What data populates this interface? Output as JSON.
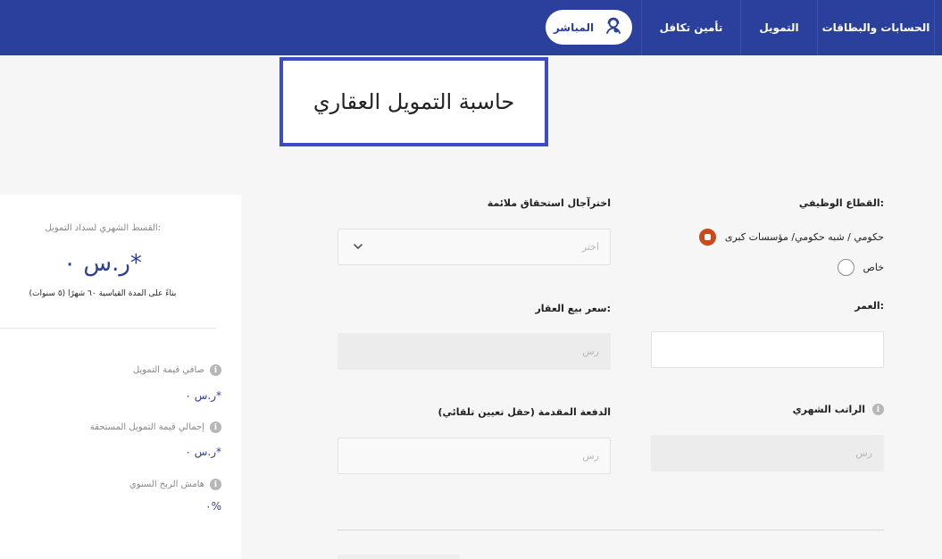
{
  "nav": {
    "items": [
      "الحسابات والبطاقات",
      "التمويل",
      "تأمين تكافل"
    ],
    "live_label": "المباشر"
  },
  "title": "حاسبة التمويل العقاري",
  "form": {
    "sector": {
      "label": "القطاع الوظيفي:",
      "options": [
        "حكومي / شبه حكومي/ مؤسسات كبرى",
        "خاص"
      ],
      "selected_index": 0
    },
    "maturity": {
      "label": "اخترآجال استحقاق ملائمة",
      "placeholder": "اختر"
    },
    "age": {
      "label": "العمر:",
      "value": ""
    },
    "price": {
      "label": "سعر بيع العقار:",
      "placeholder": "رس"
    },
    "salary": {
      "label": "الراتب الشهري",
      "placeholder": "رس"
    },
    "down_payment": {
      "label": "الدفعة المقدمة (حقل تعيين تلقائي)",
      "placeholder": "رس"
    }
  },
  "results": {
    "installment_label": "القسط الشهري لسداد التمويل:",
    "installment_value": "ر.س ٠*",
    "basis_text": "بناءً على المدة القياسية ٦٠ شهرًا (٥ سنوات)",
    "net_label": "صافي قيمة التمويل",
    "net_value": "ر.س ٠*",
    "total_label": "إجمالي قيمة التمويل المستحقة",
    "total_value": "ر.س ٠*",
    "margin_label": "هامش الربح السنوي",
    "margin_value": "٠%"
  },
  "colors": {
    "nav": "#2b3f9c",
    "accent": "#c94a1c",
    "title_border": "#3d4bc4"
  },
  "icons": {
    "live": "user-support-icon",
    "info": "info-icon",
    "chevron": "chevron-down-icon"
  }
}
